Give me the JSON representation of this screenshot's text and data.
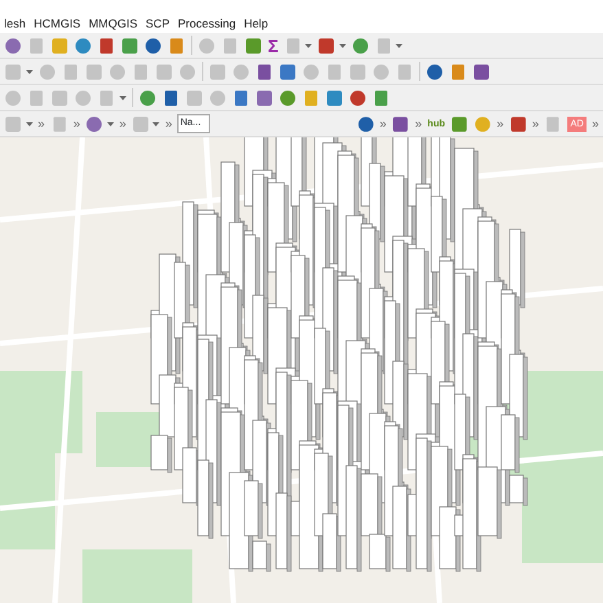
{
  "menu": [
    {
      "label": "lesh"
    },
    {
      "label": "HCMGIS"
    },
    {
      "label": "MMQGIS"
    },
    {
      "label": "SCP"
    },
    {
      "label": "Processing"
    },
    {
      "label": "Help"
    }
  ],
  "toolbars": [
    [
      {
        "kind": "icon",
        "disabled": false
      },
      {
        "kind": "icon",
        "disabled": true
      },
      {
        "kind": "icon",
        "disabled": false
      },
      {
        "kind": "icon",
        "disabled": false
      },
      {
        "kind": "icon",
        "disabled": false
      },
      {
        "kind": "icon",
        "disabled": false
      },
      {
        "kind": "icon",
        "disabled": false
      },
      {
        "kind": "icon",
        "disabled": false
      },
      {
        "kind": "separator"
      },
      {
        "kind": "icon",
        "disabled": true
      },
      {
        "kind": "icon",
        "disabled": true
      },
      {
        "kind": "icon",
        "disabled": false
      },
      {
        "kind": "glyph",
        "text": "Σ",
        "disabled": false
      },
      {
        "kind": "dropdown",
        "disabled": true
      },
      {
        "kind": "dropdown",
        "disabled": false
      },
      {
        "kind": "icon",
        "disabled": false
      },
      {
        "kind": "dropdown",
        "disabled": true
      }
    ],
    [
      {
        "kind": "dropdown",
        "disabled": true
      },
      {
        "kind": "icon",
        "disabled": true
      },
      {
        "kind": "icon",
        "disabled": true
      },
      {
        "kind": "icon",
        "disabled": true
      },
      {
        "kind": "icon",
        "disabled": true
      },
      {
        "kind": "icon",
        "disabled": true
      },
      {
        "kind": "icon",
        "disabled": true
      },
      {
        "kind": "icon",
        "disabled": true
      },
      {
        "kind": "separator"
      },
      {
        "kind": "icon",
        "disabled": true
      },
      {
        "kind": "icon",
        "disabled": true
      },
      {
        "kind": "icon",
        "disabled": false
      },
      {
        "kind": "icon",
        "disabled": false
      },
      {
        "kind": "icon",
        "disabled": true
      },
      {
        "kind": "icon",
        "disabled": true
      },
      {
        "kind": "icon",
        "disabled": true
      },
      {
        "kind": "icon",
        "disabled": true
      },
      {
        "kind": "icon",
        "disabled": true
      },
      {
        "kind": "separator"
      },
      {
        "kind": "icon",
        "disabled": false
      },
      {
        "kind": "icon",
        "disabled": false
      },
      {
        "kind": "icon",
        "disabled": false
      }
    ],
    [
      {
        "kind": "icon",
        "disabled": true
      },
      {
        "kind": "icon",
        "disabled": true
      },
      {
        "kind": "icon",
        "disabled": true
      },
      {
        "kind": "icon",
        "disabled": true
      },
      {
        "kind": "dropdown",
        "disabled": true
      },
      {
        "kind": "separator"
      },
      {
        "kind": "icon",
        "disabled": false
      },
      {
        "kind": "icon",
        "disabled": false
      },
      {
        "kind": "icon",
        "disabled": true
      },
      {
        "kind": "icon",
        "disabled": true
      },
      {
        "kind": "icon",
        "disabled": false
      },
      {
        "kind": "icon",
        "disabled": false
      },
      {
        "kind": "icon",
        "disabled": false
      },
      {
        "kind": "icon",
        "disabled": false
      },
      {
        "kind": "icon",
        "disabled": false
      },
      {
        "kind": "icon",
        "disabled": false
      },
      {
        "kind": "icon",
        "disabled": false
      }
    ],
    [
      {
        "kind": "dropdown",
        "disabled": true
      },
      {
        "kind": "chevron",
        "text": "»"
      },
      {
        "kind": "icon",
        "disabled": true
      },
      {
        "kind": "chevron",
        "text": "»"
      },
      {
        "kind": "dropdown",
        "disabled": false
      },
      {
        "kind": "chevron",
        "text": "»"
      },
      {
        "kind": "dropdown",
        "disabled": true
      },
      {
        "kind": "chevron",
        "text": "»"
      },
      {
        "kind": "field",
        "value": "Na..."
      },
      {
        "kind": "spacer"
      },
      {
        "kind": "icon",
        "disabled": false
      },
      {
        "kind": "chevron",
        "text": "»"
      },
      {
        "kind": "icon",
        "disabled": false
      },
      {
        "kind": "chevron",
        "text": "»"
      },
      {
        "kind": "hub",
        "text": "hub"
      },
      {
        "kind": "icon",
        "disabled": false
      },
      {
        "kind": "icon",
        "disabled": false
      },
      {
        "kind": "chevron",
        "text": "»"
      },
      {
        "kind": "icon",
        "disabled": false
      },
      {
        "kind": "chevron",
        "text": "»"
      },
      {
        "kind": "icon",
        "disabled": true
      },
      {
        "kind": "badge",
        "text": "AD"
      },
      {
        "kind": "chevron",
        "text": "»"
      }
    ]
  ]
}
